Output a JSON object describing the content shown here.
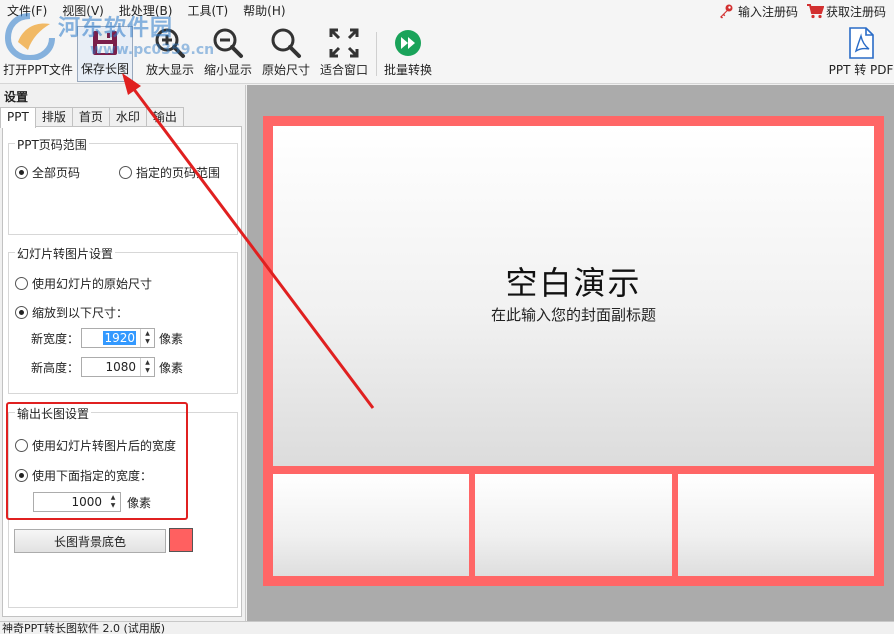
{
  "menu": {
    "items": [
      "文件(F)",
      "视图(V)",
      "批处理(B)",
      "工具(T)",
      "帮助(H)"
    ],
    "enter_code": "输入注册码",
    "get_code": "获取注册码"
  },
  "watermark": {
    "title": "河东软件园",
    "url": "www.pc0359.cn"
  },
  "toolbar": {
    "open": "打开PPT文件",
    "save": "保存长图",
    "zoom_in": "放大显示",
    "zoom_out": "缩小显示",
    "original": "原始尺寸",
    "fit": "适合窗口",
    "batch": "批量转换",
    "ppt_to_pdf": "PPT 转 PDF"
  },
  "panel": {
    "title": "设置",
    "tabs": [
      "PPT",
      "排版",
      "首页",
      "水印",
      "输出"
    ],
    "page_range": {
      "legend": "PPT页码范围",
      "all": "全部页码",
      "specified": "指定的页码范围"
    },
    "slide_to_image": {
      "legend": "幻灯片转图片设置",
      "use_original": "使用幻灯片的原始尺寸",
      "scale": "缩放到以下尺寸：",
      "width_label": "新宽度：",
      "width_value": "1920",
      "height_label": "新高度：",
      "height_value": "1080",
      "unit": "像素"
    },
    "output_long": {
      "legend": "输出长图设置",
      "use_converted": "使用幻灯片转图片后的宽度",
      "use_specified": "使用下面指定的宽度：",
      "width_value": "1000",
      "unit": "像素"
    },
    "bg_color_button": "长图背景底色"
  },
  "colors": {
    "bg_color": "#ff6060",
    "frame": "#ff6666",
    "annotation": "#e02020"
  },
  "preview": {
    "title": "空白演示",
    "subtitle": "在此输入您的封面副标题"
  },
  "status": {
    "text": "神奇PPT转长图软件 2.0 (试用版)"
  }
}
